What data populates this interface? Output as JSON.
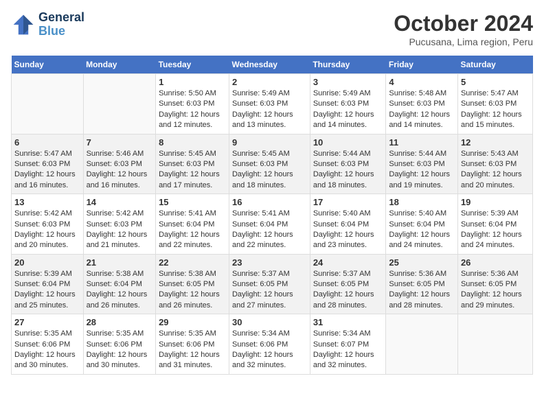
{
  "logo": {
    "line1": "General",
    "line2": "Blue"
  },
  "title": "October 2024",
  "subtitle": "Pucusana, Lima region, Peru",
  "days_of_week": [
    "Sunday",
    "Monday",
    "Tuesday",
    "Wednesday",
    "Thursday",
    "Friday",
    "Saturday"
  ],
  "weeks": [
    [
      {
        "day": "",
        "info": ""
      },
      {
        "day": "",
        "info": ""
      },
      {
        "day": "1",
        "sunrise": "5:50 AM",
        "sunset": "6:03 PM",
        "daylight": "12 hours and 12 minutes."
      },
      {
        "day": "2",
        "sunrise": "5:49 AM",
        "sunset": "6:03 PM",
        "daylight": "12 hours and 13 minutes."
      },
      {
        "day": "3",
        "sunrise": "5:49 AM",
        "sunset": "6:03 PM",
        "daylight": "12 hours and 14 minutes."
      },
      {
        "day": "4",
        "sunrise": "5:48 AM",
        "sunset": "6:03 PM",
        "daylight": "12 hours and 14 minutes."
      },
      {
        "day": "5",
        "sunrise": "5:47 AM",
        "sunset": "6:03 PM",
        "daylight": "12 hours and 15 minutes."
      }
    ],
    [
      {
        "day": "6",
        "sunrise": "5:47 AM",
        "sunset": "6:03 PM",
        "daylight": "12 hours and 16 minutes."
      },
      {
        "day": "7",
        "sunrise": "5:46 AM",
        "sunset": "6:03 PM",
        "daylight": "12 hours and 16 minutes."
      },
      {
        "day": "8",
        "sunrise": "5:45 AM",
        "sunset": "6:03 PM",
        "daylight": "12 hours and 17 minutes."
      },
      {
        "day": "9",
        "sunrise": "5:45 AM",
        "sunset": "6:03 PM",
        "daylight": "12 hours and 18 minutes."
      },
      {
        "day": "10",
        "sunrise": "5:44 AM",
        "sunset": "6:03 PM",
        "daylight": "12 hours and 18 minutes."
      },
      {
        "day": "11",
        "sunrise": "5:44 AM",
        "sunset": "6:03 PM",
        "daylight": "12 hours and 19 minutes."
      },
      {
        "day": "12",
        "sunrise": "5:43 AM",
        "sunset": "6:03 PM",
        "daylight": "12 hours and 20 minutes."
      }
    ],
    [
      {
        "day": "13",
        "sunrise": "5:42 AM",
        "sunset": "6:03 PM",
        "daylight": "12 hours and 20 minutes."
      },
      {
        "day": "14",
        "sunrise": "5:42 AM",
        "sunset": "6:03 PM",
        "daylight": "12 hours and 21 minutes."
      },
      {
        "day": "15",
        "sunrise": "5:41 AM",
        "sunset": "6:04 PM",
        "daylight": "12 hours and 22 minutes."
      },
      {
        "day": "16",
        "sunrise": "5:41 AM",
        "sunset": "6:04 PM",
        "daylight": "12 hours and 22 minutes."
      },
      {
        "day": "17",
        "sunrise": "5:40 AM",
        "sunset": "6:04 PM",
        "daylight": "12 hours and 23 minutes."
      },
      {
        "day": "18",
        "sunrise": "5:40 AM",
        "sunset": "6:04 PM",
        "daylight": "12 hours and 24 minutes."
      },
      {
        "day": "19",
        "sunrise": "5:39 AM",
        "sunset": "6:04 PM",
        "daylight": "12 hours and 24 minutes."
      }
    ],
    [
      {
        "day": "20",
        "sunrise": "5:39 AM",
        "sunset": "6:04 PM",
        "daylight": "12 hours and 25 minutes."
      },
      {
        "day": "21",
        "sunrise": "5:38 AM",
        "sunset": "6:04 PM",
        "daylight": "12 hours and 26 minutes."
      },
      {
        "day": "22",
        "sunrise": "5:38 AM",
        "sunset": "6:05 PM",
        "daylight": "12 hours and 26 minutes."
      },
      {
        "day": "23",
        "sunrise": "5:37 AM",
        "sunset": "6:05 PM",
        "daylight": "12 hours and 27 minutes."
      },
      {
        "day": "24",
        "sunrise": "5:37 AM",
        "sunset": "6:05 PM",
        "daylight": "12 hours and 28 minutes."
      },
      {
        "day": "25",
        "sunrise": "5:36 AM",
        "sunset": "6:05 PM",
        "daylight": "12 hours and 28 minutes."
      },
      {
        "day": "26",
        "sunrise": "5:36 AM",
        "sunset": "6:05 PM",
        "daylight": "12 hours and 29 minutes."
      }
    ],
    [
      {
        "day": "27",
        "sunrise": "5:35 AM",
        "sunset": "6:06 PM",
        "daylight": "12 hours and 30 minutes."
      },
      {
        "day": "28",
        "sunrise": "5:35 AM",
        "sunset": "6:06 PM",
        "daylight": "12 hours and 30 minutes."
      },
      {
        "day": "29",
        "sunrise": "5:35 AM",
        "sunset": "6:06 PM",
        "daylight": "12 hours and 31 minutes."
      },
      {
        "day": "30",
        "sunrise": "5:34 AM",
        "sunset": "6:06 PM",
        "daylight": "12 hours and 32 minutes."
      },
      {
        "day": "31",
        "sunrise": "5:34 AM",
        "sunset": "6:07 PM",
        "daylight": "12 hours and 32 minutes."
      },
      {
        "day": "",
        "info": ""
      },
      {
        "day": "",
        "info": ""
      }
    ]
  ]
}
